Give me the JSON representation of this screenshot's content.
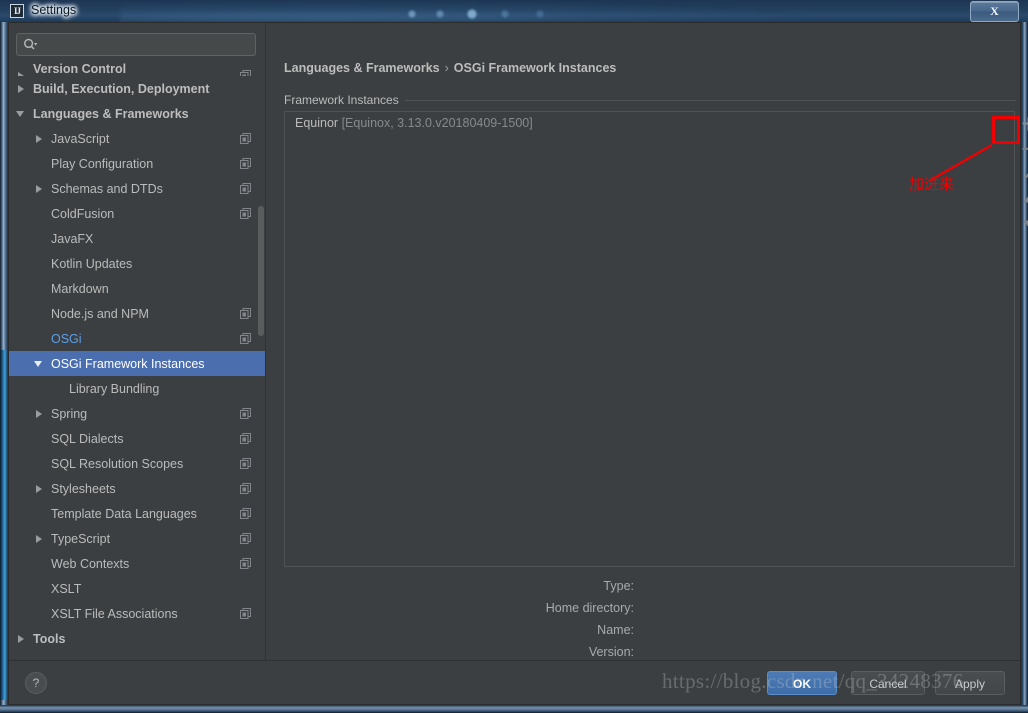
{
  "window": {
    "title": "Settings",
    "app_icon": "intellij-idea-icon",
    "close_label": "X"
  },
  "search": {
    "value": "",
    "placeholder": "",
    "icon": "search-icon"
  },
  "sidebar": {
    "items": [
      {
        "label": "Version Control",
        "level": 0,
        "bold": true,
        "expander": "right",
        "copy": true,
        "clipped": true
      },
      {
        "label": "Build, Execution, Deployment",
        "level": 0,
        "bold": true,
        "expander": "right",
        "copy": false
      },
      {
        "label": "Languages & Frameworks",
        "level": 0,
        "bold": true,
        "expander": "down",
        "copy": false
      },
      {
        "label": "JavaScript",
        "level": 1,
        "expander": "right",
        "copy": true
      },
      {
        "label": "Play Configuration",
        "level": 1,
        "expander": "none",
        "copy": true
      },
      {
        "label": "Schemas and DTDs",
        "level": 1,
        "expander": "right",
        "copy": true
      },
      {
        "label": "ColdFusion",
        "level": 1,
        "expander": "none",
        "copy": true
      },
      {
        "label": "JavaFX",
        "level": 1,
        "expander": "none",
        "copy": false
      },
      {
        "label": "Kotlin Updates",
        "level": 1,
        "expander": "none",
        "copy": false
      },
      {
        "label": "Markdown",
        "level": 1,
        "expander": "none",
        "copy": false
      },
      {
        "label": "Node.js and NPM",
        "level": 1,
        "expander": "none",
        "copy": true
      },
      {
        "label": "OSGi",
        "level": 1,
        "expander": "none",
        "copy": true,
        "modified": true
      },
      {
        "label": "OSGi Framework Instances",
        "level": 1,
        "expander": "down",
        "copy": false,
        "selected": true
      },
      {
        "label": "Library Bundling",
        "level": 2,
        "expander": "none",
        "copy": false
      },
      {
        "label": "Spring",
        "level": 1,
        "expander": "right",
        "copy": true
      },
      {
        "label": "SQL Dialects",
        "level": 1,
        "expander": "none",
        "copy": true
      },
      {
        "label": "SQL Resolution Scopes",
        "level": 1,
        "expander": "none",
        "copy": true
      },
      {
        "label": "Stylesheets",
        "level": 1,
        "expander": "right",
        "copy": true
      },
      {
        "label": "Template Data Languages",
        "level": 1,
        "expander": "none",
        "copy": true
      },
      {
        "label": "TypeScript",
        "level": 1,
        "expander": "right",
        "copy": true
      },
      {
        "label": "Web Contexts",
        "level": 1,
        "expander": "none",
        "copy": true
      },
      {
        "label": "XSLT",
        "level": 1,
        "expander": "none",
        "copy": false
      },
      {
        "label": "XSLT File Associations",
        "level": 1,
        "expander": "none",
        "copy": true
      },
      {
        "label": "Tools",
        "level": 0,
        "bold": true,
        "expander": "right",
        "copy": false
      }
    ]
  },
  "main": {
    "breadcrumb": {
      "parent": "Languages & Frameworks",
      "separator": "›",
      "current": "OSGi Framework Instances"
    },
    "group_label": "Framework Instances",
    "instances": [
      {
        "name": "Equinor",
        "detail": "[Equinox, 3.13.0.v20180409-1500]"
      }
    ],
    "toolbar": [
      {
        "name": "add-button",
        "icon": "plus-icon"
      },
      {
        "name": "remove-button",
        "icon": "minus-icon"
      },
      {
        "name": "edit-button",
        "icon": "pencil-icon"
      },
      {
        "name": "move-up-button",
        "icon": "triangle-up-icon"
      },
      {
        "name": "move-down-button",
        "icon": "triangle-down-icon"
      }
    ],
    "details": [
      {
        "label": "Type:",
        "value": ""
      },
      {
        "label": "Home directory:",
        "value": ""
      },
      {
        "label": "Name:",
        "value": ""
      },
      {
        "label": "Version:",
        "value": ""
      }
    ]
  },
  "annotation": {
    "text": "加进来",
    "color": "#f00000"
  },
  "footer": {
    "help_label": "?",
    "ok_label": "OK",
    "cancel_label": "Cancel",
    "apply_label": "Apply"
  },
  "watermark": {
    "text": "https://blog.csdn.net/qq_34248376"
  },
  "colors": {
    "background": "#3c3f41",
    "selection": "#4b6eaf",
    "modified_text": "#5c9fe8",
    "accent_primary": "#4c7bb5",
    "annotation_red": "#f00000"
  }
}
